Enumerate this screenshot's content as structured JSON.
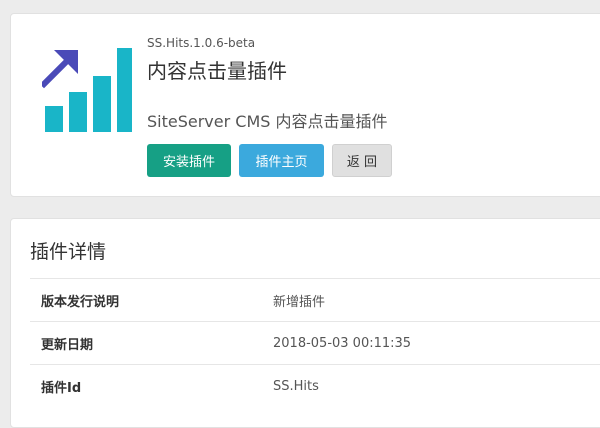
{
  "plugin": {
    "version": "SS.Hits.1.0.6-beta",
    "title": "内容点击量插件",
    "description": "SiteServer CMS 内容点击量插件",
    "icon": "bar-chart-up-icon",
    "buttons": {
      "install": "安装插件",
      "homepage": "插件主页",
      "back": "返 回"
    }
  },
  "details": {
    "heading": "插件详情",
    "rows": [
      {
        "key": "版本发行说明",
        "value": "新增插件"
      },
      {
        "key": "更新日期",
        "value": "2018-05-03 00:11:35"
      },
      {
        "key": "插件Id",
        "value": "SS.Hits"
      }
    ]
  },
  "colors": {
    "primary_green": "#16a085",
    "accent_blue": "#3ba9dd",
    "logo_cyan": "#19b5c8",
    "logo_arrow": "#4a4ab8"
  }
}
